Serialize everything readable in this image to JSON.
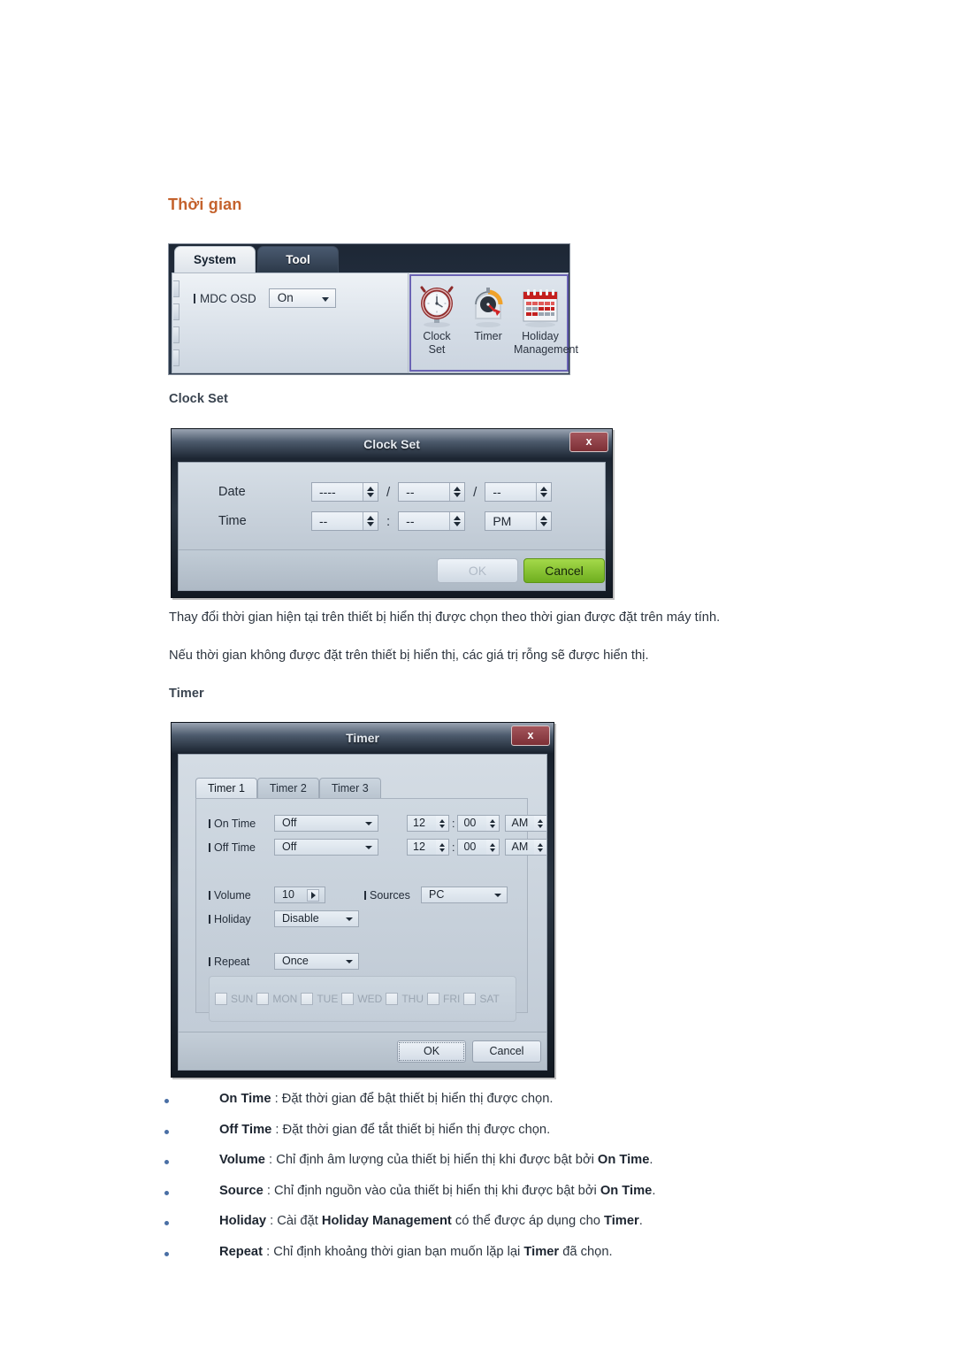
{
  "section": {
    "heading": "Thời gian",
    "accent_color": "#c4622d"
  },
  "ribbon": {
    "tabs": [
      {
        "label": "System",
        "active": true
      },
      {
        "label": "Tool",
        "active": false
      }
    ],
    "field": {
      "label": "MDC OSD",
      "value": "On"
    },
    "group_highlight_color": "#6a63b4",
    "buttons": [
      {
        "icon": "alarm-clock-icon",
        "line1": "Clock",
        "line2": "Set"
      },
      {
        "icon": "stopwatch-timer-icon",
        "line1": "Timer",
        "line2": ""
      },
      {
        "icon": "calendar-holiday-icon",
        "line1": "Holiday",
        "line2": "Management"
      }
    ]
  },
  "clock_set": {
    "label": "Clock Set",
    "title": "Clock Set",
    "close_label": "x",
    "rows": [
      {
        "label": "Date",
        "fields": [
          "----",
          "--",
          "--"
        ],
        "separators": [
          "/",
          "/"
        ]
      },
      {
        "label": "Time",
        "fields": [
          "--",
          "--",
          "PM"
        ],
        "separators": [
          ":",
          ""
        ]
      }
    ],
    "ok_label": "OK",
    "cancel_label": "Cancel",
    "ok_disabled": true,
    "cancel_color": "#7fc22a"
  },
  "clock_notes": [
    "Thay đổi thời gian hiện tại trên thiết bị hiển thị được chọn theo thời gian được đặt trên máy tính.",
    "Nếu thời gian không được đặt trên thiết bị hiển thị, các giá trị rỗng sẽ được hiển thị."
  ],
  "timer": {
    "label": "Timer",
    "title": "Timer",
    "close_label": "x",
    "tabs": [
      {
        "label": "Timer 1",
        "active": true
      },
      {
        "label": "Timer 2",
        "active": false
      },
      {
        "label": "Timer 3",
        "active": false
      }
    ],
    "on_time": {
      "label": "On Time",
      "mode": "Off",
      "hour": "12",
      "minute": "00",
      "meridiem": "AM"
    },
    "off_time": {
      "label": "Off Time",
      "mode": "Off",
      "hour": "12",
      "minute": "00",
      "meridiem": "AM"
    },
    "volume": {
      "label": "Volume",
      "value": "10"
    },
    "sources": {
      "label": "Sources",
      "value": "PC"
    },
    "holiday": {
      "label": "Holiday",
      "value": "Disable"
    },
    "repeat": {
      "label": "Repeat",
      "value": "Once"
    },
    "days": [
      {
        "name": "SUN",
        "checked": false
      },
      {
        "name": "MON",
        "checked": false
      },
      {
        "name": "TUE",
        "checked": false
      },
      {
        "name": "WED",
        "checked": false
      },
      {
        "name": "THU",
        "checked": false
      },
      {
        "name": "FRI",
        "checked": false
      },
      {
        "name": "SAT",
        "checked": false
      }
    ],
    "ok_label": "OK",
    "cancel_label": "Cancel"
  },
  "timer_bullets": [
    {
      "term": "On Time",
      "before": " : Đặt thời gian để bật thiết bị hiển thị được chọn.",
      "term2": "",
      "after": ""
    },
    {
      "term": "Off Time",
      "before": " : Đặt thời gian để tắt thiết bị hiển thị được chọn.",
      "term2": "",
      "after": ""
    },
    {
      "term": "Volume",
      "before": " : Chỉ định âm lượng của thiết bị hiển thị khi được bật bởi ",
      "term2": "On Time",
      "after": "."
    },
    {
      "term": "Source",
      "before": " : Chỉ định nguồn vào của thiết bị hiển thị khi được bật bởi ",
      "term2": "On Time",
      "after": "."
    },
    {
      "term": "Holiday",
      "before": " : Cài đặt ",
      "term2": "Holiday Management",
      "after": " có thể được áp dụng cho ",
      "term3": "Timer",
      "after2": "."
    },
    {
      "term": "Repeat",
      "before": " : Chỉ định khoảng thời gian bạn muốn lặp lại ",
      "term2": "Timer",
      "after": " đã chọn."
    }
  ],
  "bullet_color": "#4a6fa5"
}
